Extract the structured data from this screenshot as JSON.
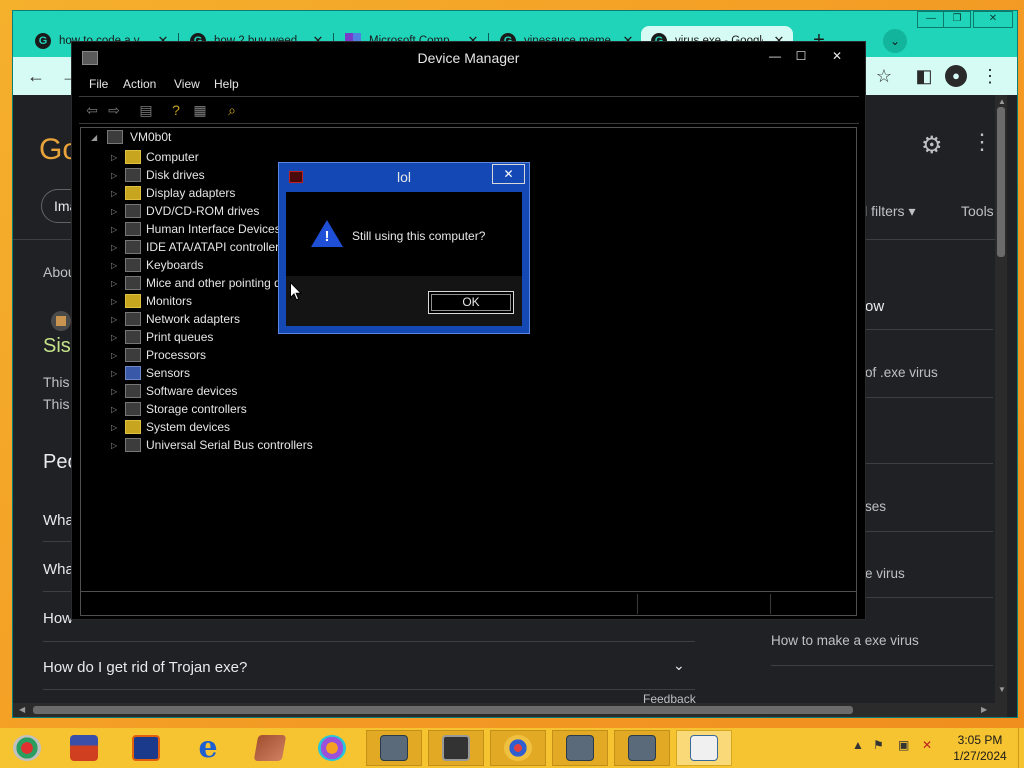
{
  "browser": {
    "tabs": [
      {
        "label": "how to code a v",
        "icon": "google-g"
      },
      {
        "label": "how 2 buy weed",
        "icon": "google-g"
      },
      {
        "label": "Microsoft Comp",
        "icon": "microsoft"
      },
      {
        "label": "vinesauce meme",
        "icon": "google-g"
      },
      {
        "label": "virus exe - Google",
        "icon": "google-g"
      }
    ],
    "new_tab": "+",
    "google_logo": "Go",
    "filter_chip": "Ima",
    "all_filters": "ll filters",
    "tools": "Tools",
    "about": "Abou",
    "result_title": "Sis",
    "result_snippet_1": "This",
    "result_snippet_2": "This",
    "people_also_ask": "Peo",
    "questions": [
      "Wha",
      "Wha",
      "How",
      "How do I get rid of Trojan exe?"
    ],
    "feedback": "Feedback",
    "right_items": [
      "ow",
      "of .exe virus",
      "ses",
      "e virus",
      "How to make a exe virus"
    ]
  },
  "device_manager": {
    "title": "Device Manager",
    "menu": [
      "File",
      "Action",
      "View",
      "Help"
    ],
    "root": "VM0b0t",
    "items": [
      {
        "label": "Computer",
        "icon": "computer-icon",
        "color": "y"
      },
      {
        "label": "Disk drives",
        "icon": "disk-icon",
        "color": ""
      },
      {
        "label": "Display adapters",
        "icon": "display-icon",
        "color": "y"
      },
      {
        "label": "DVD/CD-ROM drives",
        "icon": "dvd-icon",
        "color": ""
      },
      {
        "label": "Human Interface Devices",
        "icon": "hid-icon",
        "color": ""
      },
      {
        "label": "IDE ATA/ATAPI controller",
        "icon": "ide-icon",
        "color": ""
      },
      {
        "label": "Keyboards",
        "icon": "keyboard-icon",
        "color": ""
      },
      {
        "label": "Mice and other pointing d",
        "icon": "mouse-icon",
        "color": ""
      },
      {
        "label": "Monitors",
        "icon": "monitor-icon",
        "color": "y"
      },
      {
        "label": "Network adapters",
        "icon": "network-icon",
        "color": ""
      },
      {
        "label": "Print queues",
        "icon": "printer-icon",
        "color": ""
      },
      {
        "label": "Processors",
        "icon": "processor-icon",
        "color": ""
      },
      {
        "label": "Sensors",
        "icon": "sensor-icon",
        "color": "b"
      },
      {
        "label": "Software devices",
        "icon": "software-icon",
        "color": ""
      },
      {
        "label": "Storage controllers",
        "icon": "storage-icon",
        "color": ""
      },
      {
        "label": "System devices",
        "icon": "system-icon",
        "color": "y"
      },
      {
        "label": "Universal Serial Bus controllers",
        "icon": "usb-icon",
        "color": ""
      }
    ]
  },
  "dialog": {
    "title": "lol",
    "message": "Still using this computer?",
    "ok_label": "OK"
  },
  "taskbar": {
    "time": "3:05 PM",
    "date": "1/27/2024"
  },
  "colors": {
    "chrome_accent": "#1fd4b9",
    "dialog_blue": "#1448b5",
    "taskbar": "#f6c331"
  }
}
